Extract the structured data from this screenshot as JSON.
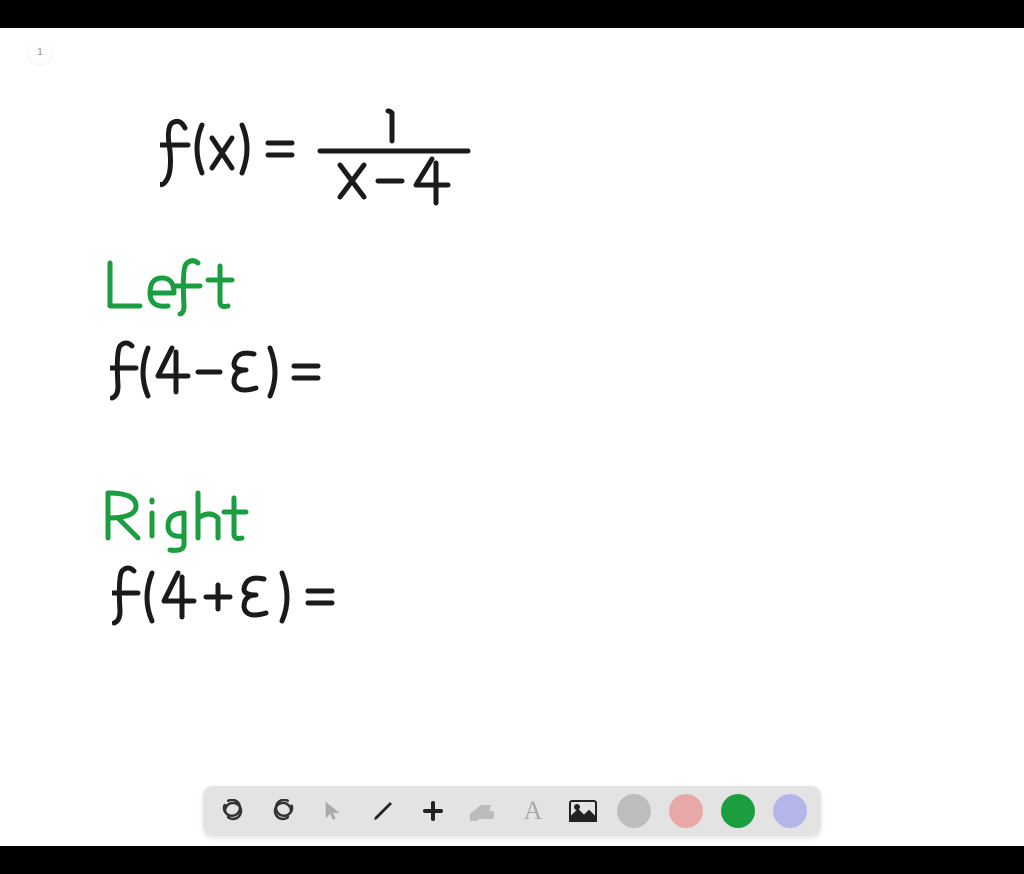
{
  "page": {
    "number": "1"
  },
  "handwriting": {
    "equation": {
      "lhs": "f(x) =",
      "numerator": "1",
      "denominator": "x − 4"
    },
    "left_label": "Left",
    "left_expr": "f(4−ε) =",
    "right_label": "Right",
    "right_expr": "f(4+ε) ="
  },
  "toolbar": {
    "undo": "undo",
    "redo": "redo",
    "select": "select",
    "pencil": "pencil",
    "add": "add",
    "eraser": "eraser",
    "text": "text",
    "image": "image"
  },
  "colors": {
    "gray": "#bdbdbd",
    "pink": "#e8a8a8",
    "green": "#1a9e3f",
    "lavender": "#b5b5e8"
  }
}
